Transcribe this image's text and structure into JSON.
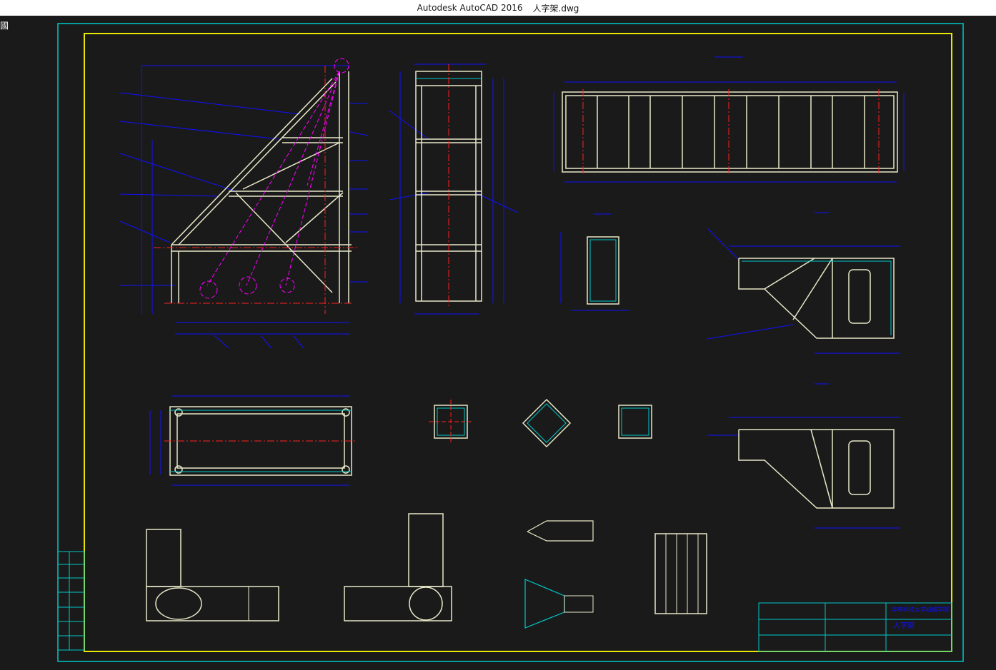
{
  "window": {
    "app_name": "Autodesk AutoCAD 2016",
    "document_name": "人字架.dwg"
  },
  "corner_glyph": "國",
  "colors": {
    "background": "#1a1a1a",
    "border_outer": "#00c8c8",
    "border_inner": "#e8e800",
    "dimension": "#1010ff",
    "center_line": "#ff2020",
    "hidden_line": "#ff00ff",
    "object_line": "#e8e8c8",
    "section_fill": "#00c8c8"
  },
  "title_block": {
    "company": "华中科技大学机械学院",
    "drawing_title": "人字架"
  }
}
